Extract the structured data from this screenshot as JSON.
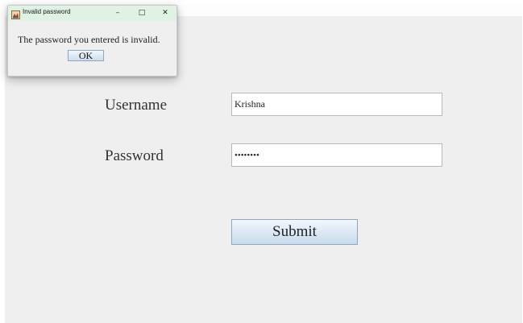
{
  "main_window": {
    "username_label": "Username",
    "username_value": "Krishna",
    "password_label": "Password",
    "password_value": "••••••••",
    "submit_label": "Submit"
  },
  "dialog": {
    "title": "Invalid password",
    "message": "The password you entered is invalid.",
    "ok_label": "OK",
    "minimize_glyph": "–",
    "maximize_glyph": "□",
    "close_glyph": "✕",
    "titlebar_color": "#dff2e4",
    "app_icon": "java-app-icon"
  },
  "colors": {
    "window_background": "#efefef",
    "button_gradient_top": "#f3f8fd",
    "button_gradient_bottom": "#c9dbec",
    "button_border": "#8ea7be"
  }
}
